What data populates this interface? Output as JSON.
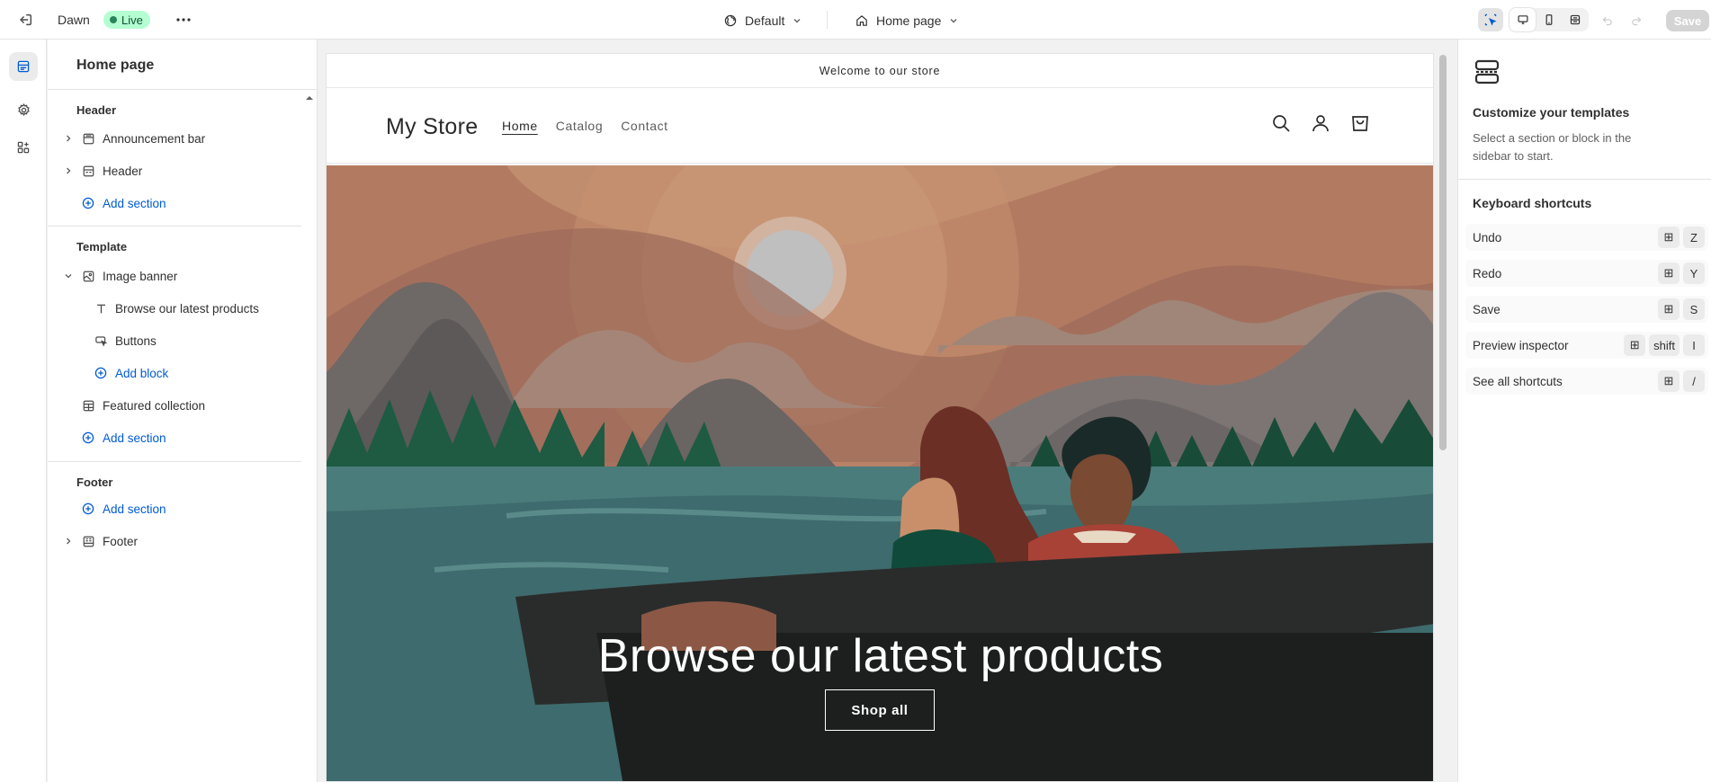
{
  "topbar": {
    "theme_name": "Dawn",
    "live_badge": "Live",
    "theme_select": "Default",
    "page_select": "Home page",
    "save_label": "Save"
  },
  "sidebar": {
    "title": "Home page",
    "groups": {
      "header": {
        "title": "Header",
        "items": [
          "Announcement bar",
          "Header"
        ],
        "add_label": "Add section"
      },
      "template": {
        "title": "Template",
        "section": "Image banner",
        "blocks": [
          "Browse our latest products",
          "Buttons"
        ],
        "add_block_label": "Add block",
        "section2": "Featured collection",
        "add_label": "Add section"
      },
      "footer": {
        "title": "Footer",
        "add_label": "Add section",
        "items": [
          "Footer"
        ]
      }
    }
  },
  "preview": {
    "announcement": "Welcome to our store",
    "store_name": "My Store",
    "nav": [
      "Home",
      "Catalog",
      "Contact"
    ],
    "banner_heading": "Browse our latest products",
    "banner_button": "Shop all"
  },
  "right_panel": {
    "title": "Customize your templates",
    "description": "Select a section or block in the sidebar to start.",
    "shortcuts_title": "Keyboard shortcuts",
    "shortcuts": [
      {
        "label": "Undo",
        "keys": [
          "⊞",
          "Z"
        ]
      },
      {
        "label": "Redo",
        "keys": [
          "⊞",
          "Y"
        ]
      },
      {
        "label": "Save",
        "keys": [
          "⊞",
          "S"
        ]
      },
      {
        "label": "Preview inspector",
        "keys": [
          "⊞",
          "shift",
          "I"
        ]
      },
      {
        "label": "See all shortcuts",
        "keys": [
          "⊞",
          "/"
        ]
      }
    ]
  },
  "colors": {
    "accent": "#005bd3",
    "live_bg": "#b4fed2",
    "live_text": "#0c5132"
  }
}
